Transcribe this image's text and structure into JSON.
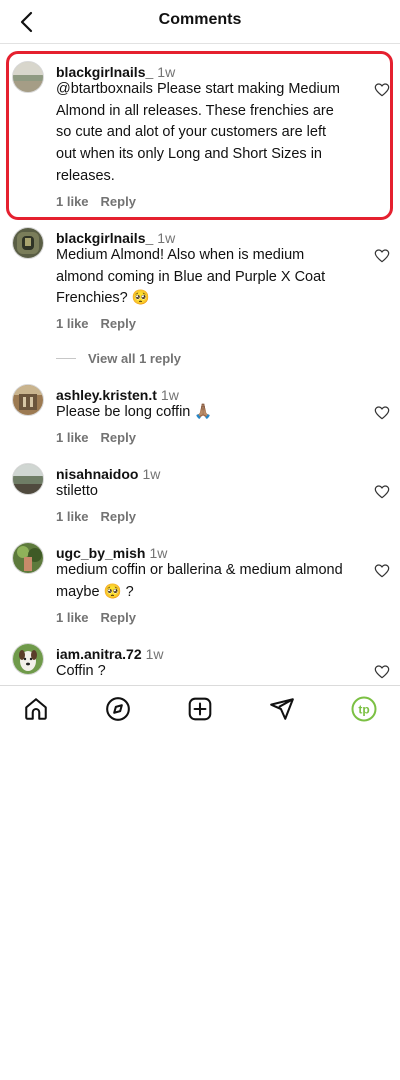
{
  "header": {
    "title": "Comments",
    "back_icon": "chevron-left-icon"
  },
  "comments": [
    {
      "username": "blackgirlnails_",
      "time": "1w",
      "text": "@btartboxnails Please start making Medium Almond in all releases. These frenchies are so cute and alot of your customers are left out when its only Long and Short Sizes in releases.",
      "likes": "1 like",
      "reply": "Reply",
      "highlighted": true
    },
    {
      "username": "blackgirlnails_",
      "time": "1w",
      "text": "Medium Almond! Also when is medium almond coming in Blue and Purple X Coat Frenchies? 🥺",
      "likes": "1 like",
      "reply": "Reply",
      "view_replies": "View all 1 reply"
    },
    {
      "username": "ashley.kristen.t",
      "time": "1w",
      "text": "Please be long coffin 🙏🏽",
      "likes": "1 like",
      "reply": "Reply"
    },
    {
      "username": "nisahnaidoo",
      "time": "1w",
      "text": "stiletto",
      "likes": "1 like",
      "reply": "Reply"
    },
    {
      "username": "ugc_by_mish",
      "time": "1w",
      "text": "medium coffin or ballerina & medium almond maybe 🥺 ?",
      "likes": "1 like",
      "reply": "Reply"
    },
    {
      "username": "iam.anitra.72",
      "time": "1w",
      "text": "Coffin ?"
    }
  ],
  "tabbar": {
    "items": [
      "home-icon",
      "explore-icon",
      "create-icon",
      "direct-message-icon",
      "profile-icon"
    ],
    "profile_badge": "tp",
    "profile_badge_color": "#7bc043"
  },
  "colors": {
    "highlight_border": "#e5202f",
    "secondary_text": "#737373"
  }
}
